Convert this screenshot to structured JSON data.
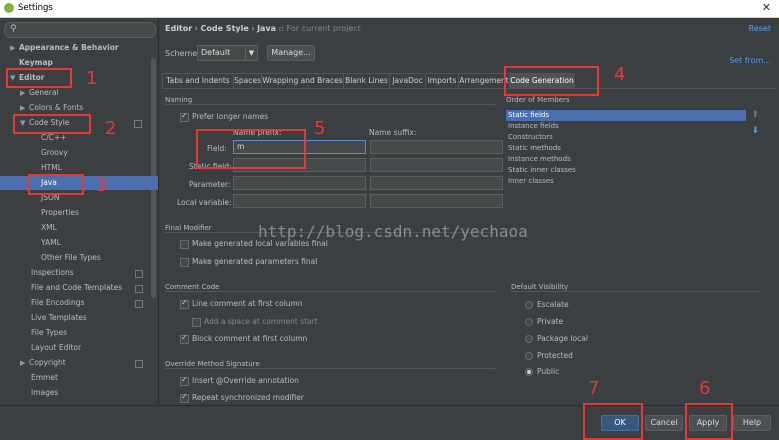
{
  "window": {
    "title": "Settings",
    "close": "✕"
  },
  "sidebar": {
    "search_placeholder": "",
    "items": [
      {
        "label": "Appearance & Behavior",
        "arrow": "▶"
      },
      {
        "label": "Keymap",
        "arrow": ""
      },
      {
        "label": "Editor",
        "arrow": "▼"
      },
      {
        "label": "General",
        "arrow": "▶"
      },
      {
        "label": "Colors & Fonts",
        "arrow": "▶"
      },
      {
        "label": "Code Style",
        "arrow": "▼"
      },
      {
        "label": "C/C++",
        "arrow": ""
      },
      {
        "label": "Groovy",
        "arrow": ""
      },
      {
        "label": "HTML",
        "arrow": ""
      },
      {
        "label": "Java",
        "arrow": ""
      },
      {
        "label": "JSON",
        "arrow": ""
      },
      {
        "label": "Properties",
        "arrow": ""
      },
      {
        "label": "XML",
        "arrow": ""
      },
      {
        "label": "YAML",
        "arrow": ""
      },
      {
        "label": "Other File Types",
        "arrow": ""
      },
      {
        "label": "Inspections",
        "arrow": ""
      },
      {
        "label": "File and Code Templates",
        "arrow": ""
      },
      {
        "label": "File Encodings",
        "arrow": ""
      },
      {
        "label": "Live Templates",
        "arrow": ""
      },
      {
        "label": "File Types",
        "arrow": ""
      },
      {
        "label": "Layout Editor",
        "arrow": ""
      },
      {
        "label": "Copyright",
        "arrow": "▶"
      },
      {
        "label": "Emmet",
        "arrow": ""
      },
      {
        "label": "Images",
        "arrow": ""
      }
    ]
  },
  "header": {
    "crumb1": "Editor",
    "sep": "›",
    "crumb2": "Code Style",
    "crumb3": "Java",
    "for_project": "For current project",
    "reset": "Reset",
    "set_from": "Set from..."
  },
  "scheme": {
    "label": "Scheme:",
    "value": "Default",
    "manage": "Manage..."
  },
  "tabs": [
    "Tabs and Indents",
    "Spaces",
    "Wrapping and Braces",
    "Blank Lines",
    "JavaDoc",
    "Imports",
    "Arrangement",
    "Code Generation"
  ],
  "naming": {
    "section": "Naming",
    "prefer_longer": "Prefer longer names",
    "name_prefix": "Name prefix:",
    "name_suffix": "Name suffix:",
    "rows": [
      {
        "label": "Field:",
        "prefix": "m",
        "suffix": ""
      },
      {
        "label": "Static field:",
        "prefix": "",
        "suffix": ""
      },
      {
        "label": "Parameter:",
        "prefix": "",
        "suffix": ""
      },
      {
        "label": "Local variable:",
        "prefix": "",
        "suffix": ""
      }
    ]
  },
  "final_modifier": {
    "section": "Final Modifier",
    "opt1": "Make generated local variables final",
    "opt2": "Make generated parameters final"
  },
  "comment_code": {
    "section": "Comment Code",
    "opt1": "Line comment at first column",
    "opt2": "Add a space at comment start",
    "opt3": "Block comment at first column"
  },
  "override": {
    "section": "Override Method Signature",
    "opt1": "Insert @Override annotation",
    "opt2": "Repeat synchronized modifier"
  },
  "order": {
    "section": "Order of Members",
    "items": [
      "Static fields",
      "Instance fields",
      "Constructors",
      "Static methods",
      "Instance methods",
      "Static inner classes",
      "Inner classes"
    ],
    "up": "⬆",
    "down": "⬇"
  },
  "visibility": {
    "section": "Default Visibility",
    "options": [
      "Escalate",
      "Private",
      "Package local",
      "Protected",
      "Public"
    ],
    "selected": "Public"
  },
  "buttons": {
    "ok": "OK",
    "cancel": "Cancel",
    "apply": "Apply",
    "help": "Help"
  },
  "annotations": {
    "n1": "1",
    "n2": "2",
    "n3": "3",
    "n4": "4",
    "n5": "5",
    "n6": "6",
    "n7": "7"
  },
  "watermark": "http://blog.csdn.net/yechaoa",
  "colors": {
    "accent": "#4b6eaf",
    "link": "#589df6",
    "annotation": "#e53935",
    "background": "#3c3f41"
  }
}
